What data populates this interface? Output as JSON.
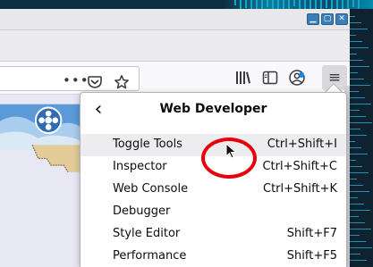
{
  "window": {
    "minimize_glyph": "▁",
    "maximize_glyph": "▢",
    "close_glyph": "✕"
  },
  "toolbar": {
    "page_actions_glyph": "•••",
    "pocket_glyph": "⛉",
    "bookmark_glyph": "☆",
    "library_glyph": "⫼",
    "sidebar_glyph": "▥",
    "account_glyph": "☺",
    "menu_glyph": "≡",
    "icons": [
      "page-actions-icon",
      "pocket-icon",
      "bookmark-star-icon",
      "library-icon",
      "sidebar-icon",
      "account-icon",
      "hamburger-menu-icon"
    ]
  },
  "menu": {
    "back_glyph": "‹",
    "title": "Web Developer",
    "items": [
      {
        "label": "Toggle Tools",
        "shortcut": "Ctrl+Shift+I"
      },
      {
        "label": "Inspector",
        "shortcut": "Ctrl+Shift+C"
      },
      {
        "label": "Web Console",
        "shortcut": "Ctrl+Shift+K"
      },
      {
        "label": "Debugger",
        "shortcut": ""
      },
      {
        "label": "Style Editor",
        "shortcut": "Shift+F7"
      },
      {
        "label": "Performance",
        "shortcut": "Shift+F5"
      }
    ]
  },
  "colors": {
    "annotation_circle": "#e8000b",
    "window_buttons": "#3c7fb7",
    "accent_dot": "#0a84ff",
    "desktop": "#0d2d43"
  }
}
